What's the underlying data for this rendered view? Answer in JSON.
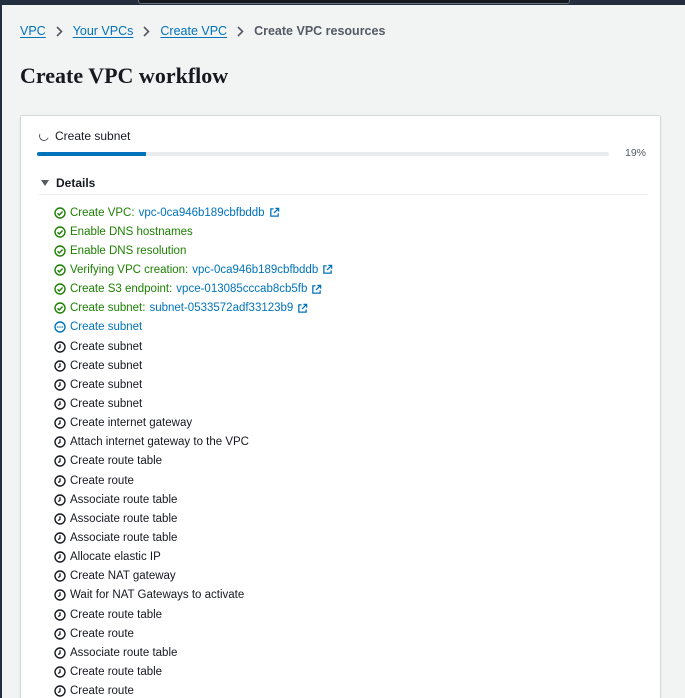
{
  "colors": {
    "header": "#232f3e",
    "page_bg": "#f2f3f3",
    "link": "#0073bb",
    "success": "#1d8102",
    "text": "#16191f",
    "muted": "#545b64"
  },
  "breadcrumb": {
    "items": [
      "VPC",
      "Your VPCs",
      "Create VPC"
    ],
    "current": "Create VPC resources"
  },
  "page_title": "Create VPC workflow",
  "status": {
    "label": "Create subnet",
    "progress_percent": 19,
    "progress_text": "19%"
  },
  "details": {
    "label": "Details",
    "steps": [
      {
        "label": "Create VPC:",
        "status": "success",
        "link": "vpc-0ca946b189cbfbddb"
      },
      {
        "label": "Enable DNS hostnames",
        "status": "success"
      },
      {
        "label": "Enable DNS resolution",
        "status": "success"
      },
      {
        "label": "Verifying VPC creation:",
        "status": "success",
        "link": "vpc-0ca946b189cbfbddb"
      },
      {
        "label": "Create S3 endpoint:",
        "status": "success",
        "link": "vpce-013085cccab8cb5fb"
      },
      {
        "label": "Create subnet:",
        "status": "success",
        "link": "subnet-0533572adf33123b9"
      },
      {
        "label": "Create subnet",
        "status": "in-progress"
      },
      {
        "label": "Create subnet",
        "status": "pending"
      },
      {
        "label": "Create subnet",
        "status": "pending"
      },
      {
        "label": "Create subnet",
        "status": "pending"
      },
      {
        "label": "Create subnet",
        "status": "pending"
      },
      {
        "label": "Create internet gateway",
        "status": "pending"
      },
      {
        "label": "Attach internet gateway to the VPC",
        "status": "pending"
      },
      {
        "label": "Create route table",
        "status": "pending"
      },
      {
        "label": "Create route",
        "status": "pending"
      },
      {
        "label": "Associate route table",
        "status": "pending"
      },
      {
        "label": "Associate route table",
        "status": "pending"
      },
      {
        "label": "Associate route table",
        "status": "pending"
      },
      {
        "label": "Allocate elastic IP",
        "status": "pending"
      },
      {
        "label": "Create NAT gateway",
        "status": "pending"
      },
      {
        "label": "Wait for NAT Gateways to activate",
        "status": "pending"
      },
      {
        "label": "Create route table",
        "status": "pending"
      },
      {
        "label": "Create route",
        "status": "pending"
      },
      {
        "label": "Associate route table",
        "status": "pending"
      },
      {
        "label": "Create route table",
        "status": "pending"
      },
      {
        "label": "Create route",
        "status": "pending"
      }
    ]
  }
}
